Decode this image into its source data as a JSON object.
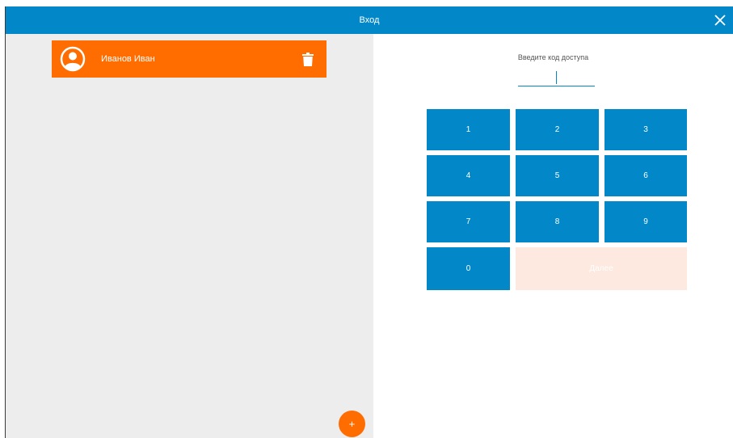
{
  "window": {
    "title": "Вход",
    "close_icon": "close-icon"
  },
  "users": {
    "items": [
      {
        "name": "Иванов Иван",
        "avatar_icon": "user-avatar-icon",
        "delete_icon": "trash-icon"
      }
    ]
  },
  "add_button": {
    "label": "+"
  },
  "login": {
    "prompt": "Введите код доступа",
    "code_value": ""
  },
  "keypad": {
    "keys": [
      "1",
      "2",
      "3",
      "4",
      "5",
      "6",
      "7",
      "8",
      "9",
      "0"
    ],
    "done_label": "Далее"
  },
  "colors": {
    "header": "#0288c9",
    "accent": "#ff6d00",
    "key": "#0288c9",
    "done_disabled": "#fde9df",
    "panel_bg": "#ededed"
  }
}
